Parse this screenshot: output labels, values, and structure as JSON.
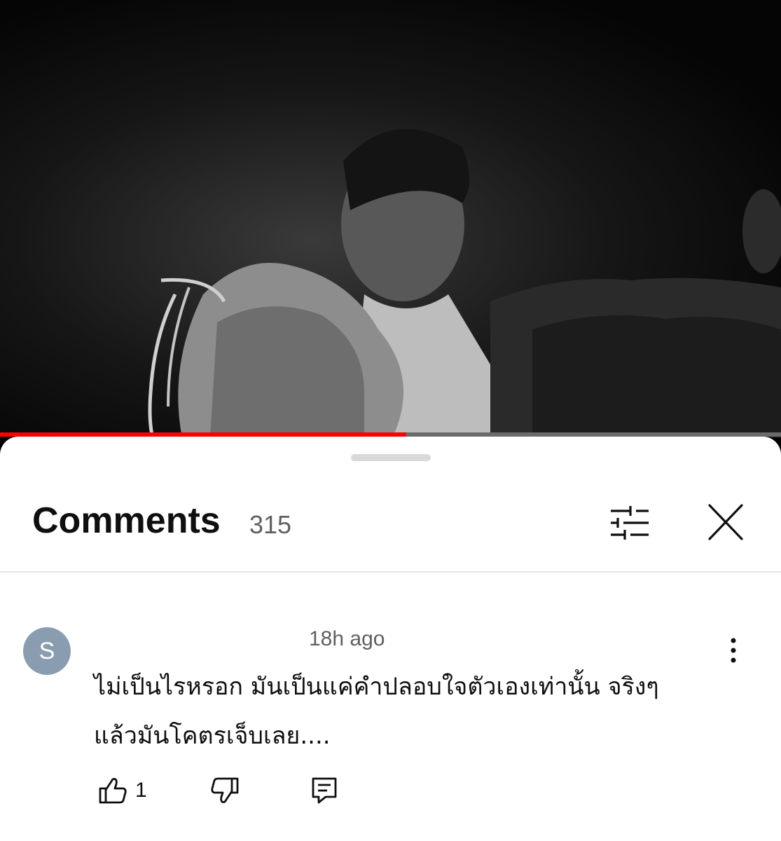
{
  "video": {
    "progress_fraction": 0.52,
    "progress_color": "#ff0000"
  },
  "comments_panel": {
    "title": "Comments",
    "count": "315",
    "filter_icon": "sliders-icon",
    "close_icon": "close-icon"
  },
  "comments": [
    {
      "avatar_letter": "S",
      "avatar_color": "#8a9db0",
      "timestamp": "18h ago",
      "text_line1": "ไม่เป็นไรหรอก มันเป็นแค่คำปลอบใจตัวเองเท่านั้น จริงๆ",
      "text_line2": "แล้วมันโคตรเจ็บเลย....",
      "like_count": "1",
      "menu_icon": "more-vertical-icon",
      "like_icon": "thumbs-up-icon",
      "dislike_icon": "thumbs-down-icon",
      "reply_icon": "reply-icon"
    }
  ]
}
